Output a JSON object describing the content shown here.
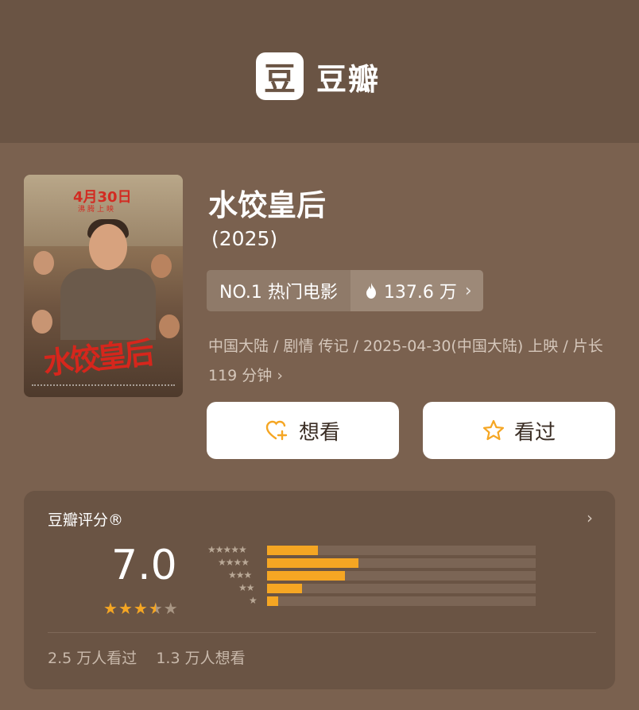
{
  "header": {
    "logo_char": "豆",
    "app_name": "豆瓣"
  },
  "movie": {
    "title": "水饺皇后",
    "year": "(2025)",
    "rank_label": "NO.1 热门电影",
    "heat": "137.6 万",
    "meta": "中国大陆 / 剧情 传记 / 2025-04-30(中国大陆) 上映 / 片长 119 分钟",
    "poster": {
      "date": "4月30日",
      "subtitle": "沸腾上映",
      "title_art": "水饺皇后"
    }
  },
  "actions": {
    "want_label": "想看",
    "watched_label": "看过"
  },
  "rating": {
    "label": "豆瓣评分®",
    "score": "7.0",
    "stars": 3.5,
    "distribution": [
      {
        "stars": 5,
        "glyph": "★★★★★",
        "fraction": 0.19
      },
      {
        "stars": 4,
        "glyph": "★★★★",
        "fraction": 0.34
      },
      {
        "stars": 3,
        "glyph": "★★★",
        "fraction": 0.29
      },
      {
        "stars": 2,
        "glyph": "★★",
        "fraction": 0.13
      },
      {
        "stars": 1,
        "glyph": "★",
        "fraction": 0.04
      }
    ],
    "watched_count": "2.5 万人看过",
    "want_count": "1.3 万人想看"
  },
  "colors": {
    "background": "#7a614f",
    "header": "#6a5444",
    "accent_star": "#f5a623",
    "button_bg": "#ffffff"
  }
}
